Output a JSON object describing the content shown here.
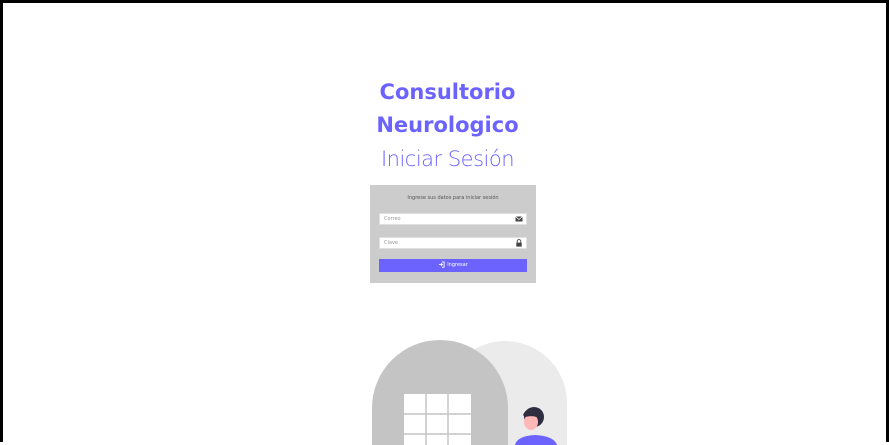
{
  "header": {
    "title_line1": "Consultorio",
    "title_line2": "Neurologico",
    "subtitle": "Iniciar Sesión"
  },
  "login": {
    "message": "Ingrese sus datos para iniciar sesión",
    "email_placeholder": "Correo",
    "password_placeholder": "Clave",
    "submit_label": "Ingresar"
  },
  "icons": {
    "email": "envelope-icon",
    "password": "lock-icon",
    "submit": "sign-in-icon"
  },
  "colors": {
    "accent": "#6c63ff",
    "card_bg": "#cccccc",
    "arch": "#c4c4c4",
    "arch_shadow": "#ebebeb"
  }
}
